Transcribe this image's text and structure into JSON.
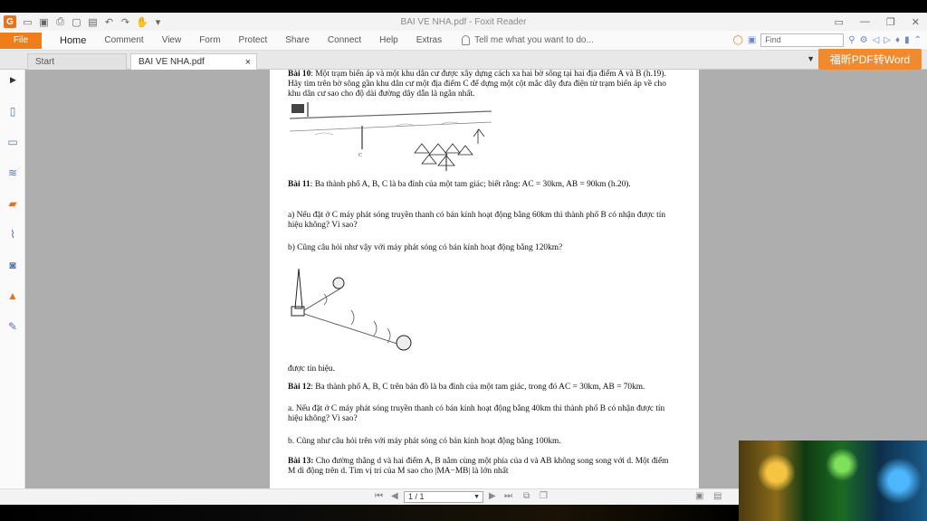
{
  "window": {
    "title": "BAI VE NHA.pdf - Foxit Reader",
    "app_letter": "G"
  },
  "ribbon": {
    "file_label": "File",
    "tabs": [
      "Home",
      "Comment",
      "View",
      "Form",
      "Protect",
      "Share",
      "Connect",
      "Help",
      "Extras"
    ],
    "tell_me": "Tell me what you want to do...",
    "find_placeholder": "Find"
  },
  "doc_tabs": {
    "start": "Start",
    "active": "BAI VE NHA.pdf"
  },
  "badge": "福昕PDF转Word",
  "document": {
    "b10_title": "Bài 10",
    "b10_text": ": Một trạm biến áp và một khu dân cư được xây dựng cách xa hai bờ sông tại hai địa điểm A và B (h.19). Hãy tìm trên bờ sông gần khu dân cư một địa điểm C để dựng một cột mắc dây đưa điện từ trạm biến áp về cho khu dân cư sao cho độ dài đường dây dẫn là ngắn nhất.",
    "b11_title": "Bài 11",
    "b11_text": ": Ba thành phố A, B, C là ba đỉnh của một tam giác; biết rằng: AC = 30km, AB = 90km (h.20).",
    "b11_a": "a) Nếu đặt ở C máy phát sóng truyền thanh có bán kính hoạt động bằng 60km thì thành phố B có nhận được tín hiệu không? Vì sao?",
    "b11_b": "b) Cũng câu hỏi như vậy với máy phát sóng có bán kính hoạt động bằng 120km?",
    "caption": "được tín hiệu.",
    "b12_title": "Bài 12",
    "b12_text": ": Ba thành phố A, B, C trên bản đồ là ba đỉnh của một tam giác, trong đó AC = 30km, AB = 70km.",
    "b12_a": "a. Nếu đặt ở C máy phát sóng truyền thanh có bán kính hoạt động bằng 40km thì thành phố B có nhận được tín hiệu không? Vì sao?",
    "b12_b": "b. Cũng như câu hỏi trên với máy phát sóng có bán kính hoạt động bằng 100km.",
    "b13_title": "Bài 13:",
    "b13_text": " Cho đường thẳng d và hai điểm A, B nằm cùng một phía của d và AB không song song với d. Một điểm M di động trên d. Tìm vị trí của M sao cho |MA−MB| là lớn nhất"
  },
  "status": {
    "page": "1 / 1"
  },
  "colors": {
    "accent": "#ef7e1a",
    "badge": "#f08a2e"
  }
}
